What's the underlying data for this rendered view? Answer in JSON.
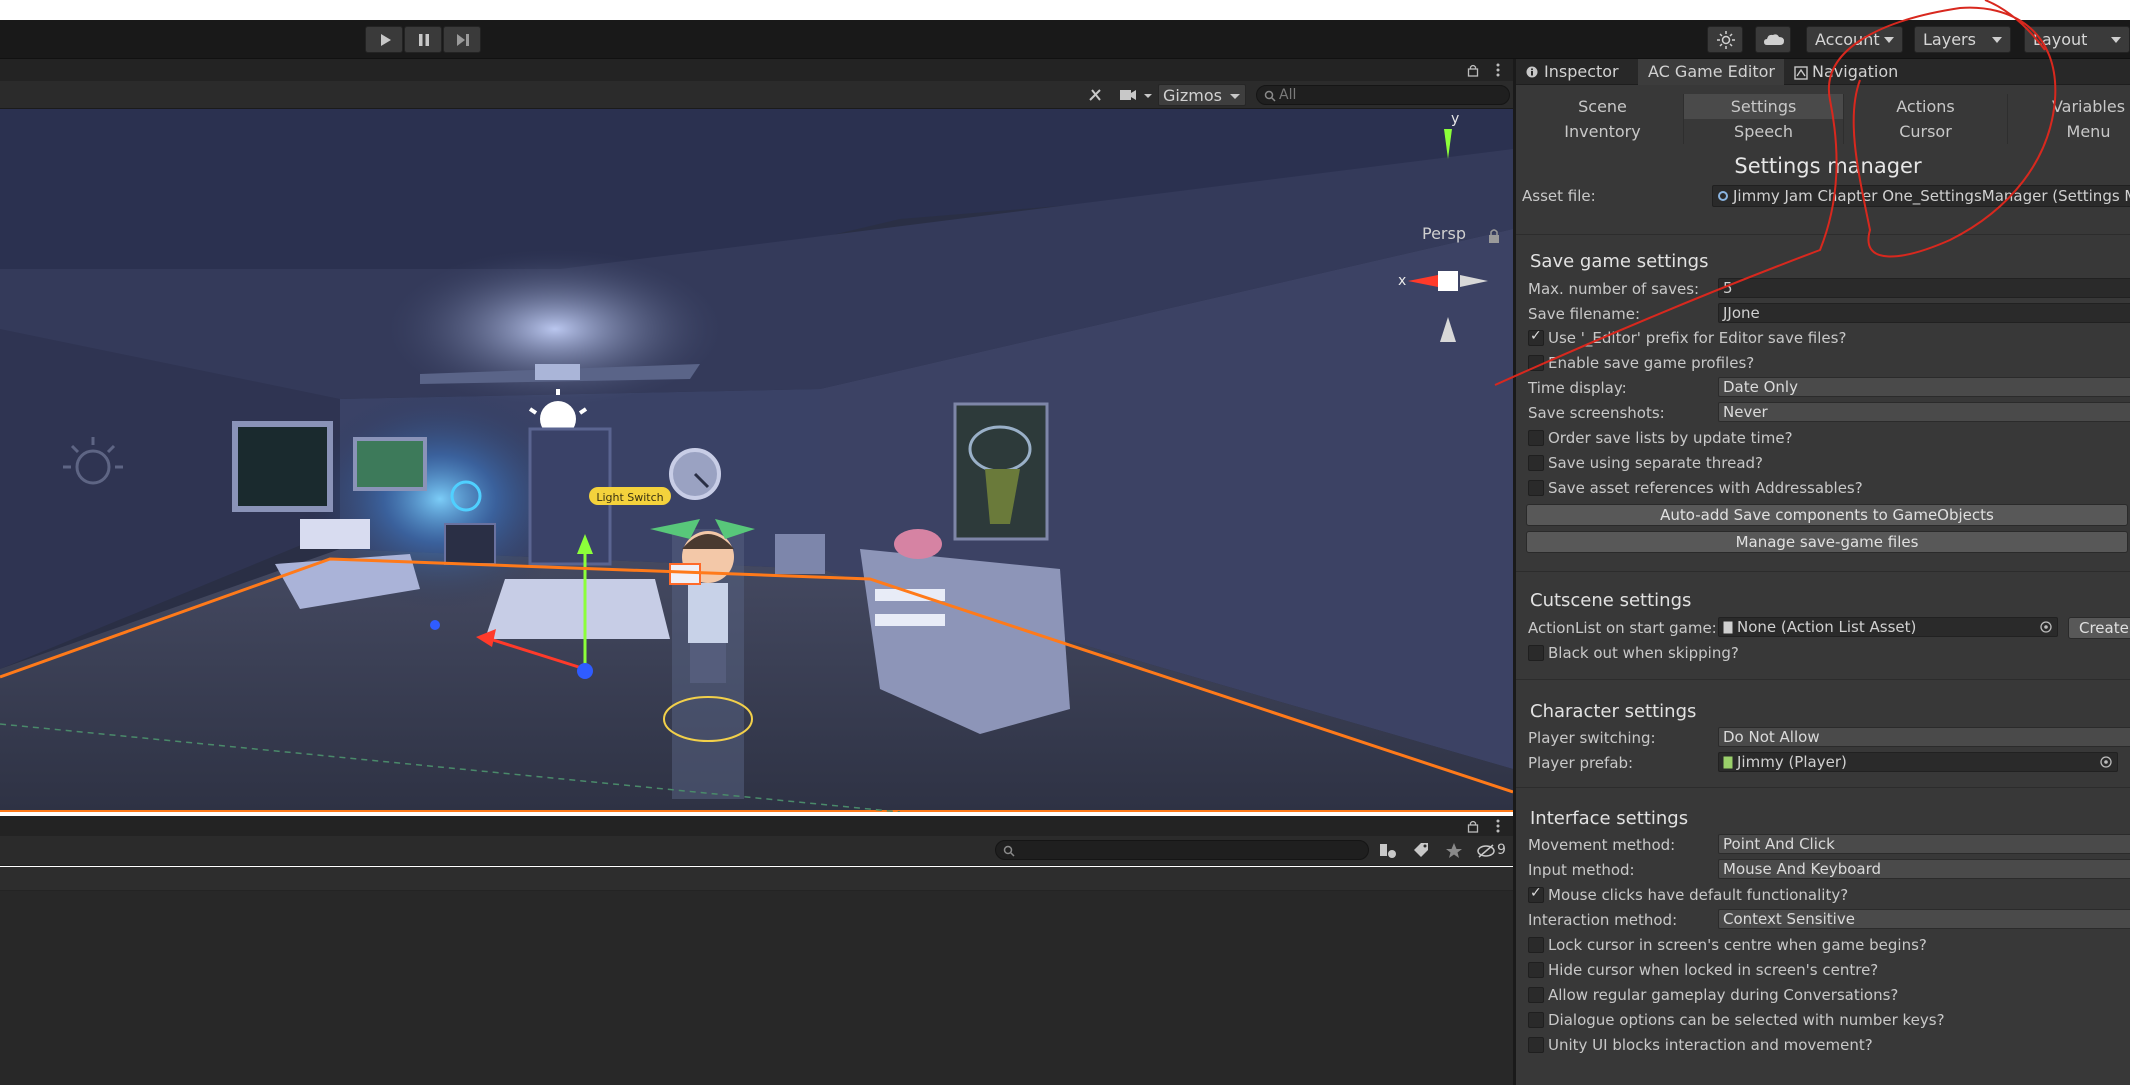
{
  "toolbar": {
    "account_label": "Account",
    "layers_label": "Layers",
    "layout_label": "Layout"
  },
  "scene": {
    "gizmos_label": "Gizmos",
    "search_placeholder": "All",
    "axis_y": "y",
    "axis_x": "x",
    "persp_label": "Persp",
    "light_switch_label": "Light Switch"
  },
  "hierarchy": {
    "hidden_count": "9"
  },
  "inspector": {
    "tabs": [
      {
        "label": "Inspector"
      },
      {
        "label": "AC Game Editor"
      },
      {
        "label": "Navigation"
      }
    ],
    "subtabs_row1": [
      "Scene",
      "Settings",
      "Actions",
      "Variables"
    ],
    "subtabs_row2": [
      "Inventory",
      "Speech",
      "Cursor",
      "Menu"
    ],
    "title": "Settings manager",
    "asset_file_label": "Asset file:",
    "asset_file_value": "Jimmy Jam Chapter One_SettingsManager (Settings Ma",
    "save": {
      "header": "Save game settings",
      "max_saves_label": "Max. number of saves:",
      "max_saves_value": "5",
      "filename_label": "Save filename:",
      "filename_value": "JJone",
      "editor_prefix_label": "Use '_Editor' prefix for Editor save files?",
      "profiles_label": "Enable save game profiles?",
      "time_display_label": "Time display:",
      "time_display_value": "Date Only",
      "screenshots_label": "Save screenshots:",
      "screenshots_value": "Never",
      "order_label": "Order save lists by update time?",
      "thread_label": "Save using separate thread?",
      "addressables_label": "Save asset references with Addressables?",
      "autoadd_button": "Auto-add Save components to GameObjects",
      "manage_button": "Manage save-game files"
    },
    "cutscene": {
      "header": "Cutscene settings",
      "start_label": "ActionList on start game:",
      "start_value": "None (Action List Asset)",
      "create_button": "Create",
      "blackout_label": "Black out when skipping?"
    },
    "character": {
      "header": "Character settings",
      "switching_label": "Player switching:",
      "switching_value": "Do Not Allow",
      "prefab_label": "Player prefab:",
      "prefab_value": "Jimmy (Player)"
    },
    "interface": {
      "header": "Interface settings",
      "movement_label": "Movement method:",
      "movement_value": "Point And Click",
      "input_label": "Input method:",
      "input_value": "Mouse And Keyboard",
      "mouse_default_label": "Mouse clicks have default functionality?",
      "interaction_label": "Interaction method:",
      "interaction_value": "Context Sensitive",
      "lock_label": "Lock cursor in screen's centre when game begins?",
      "hide_label": "Hide cursor when locked in screen's centre?",
      "allow_label": "Allow regular gameplay during Conversations?",
      "dialogue_label": "Dialogue options can be selected with number keys?",
      "unity_ui_label": "Unity UI blocks interaction and movement?"
    }
  }
}
